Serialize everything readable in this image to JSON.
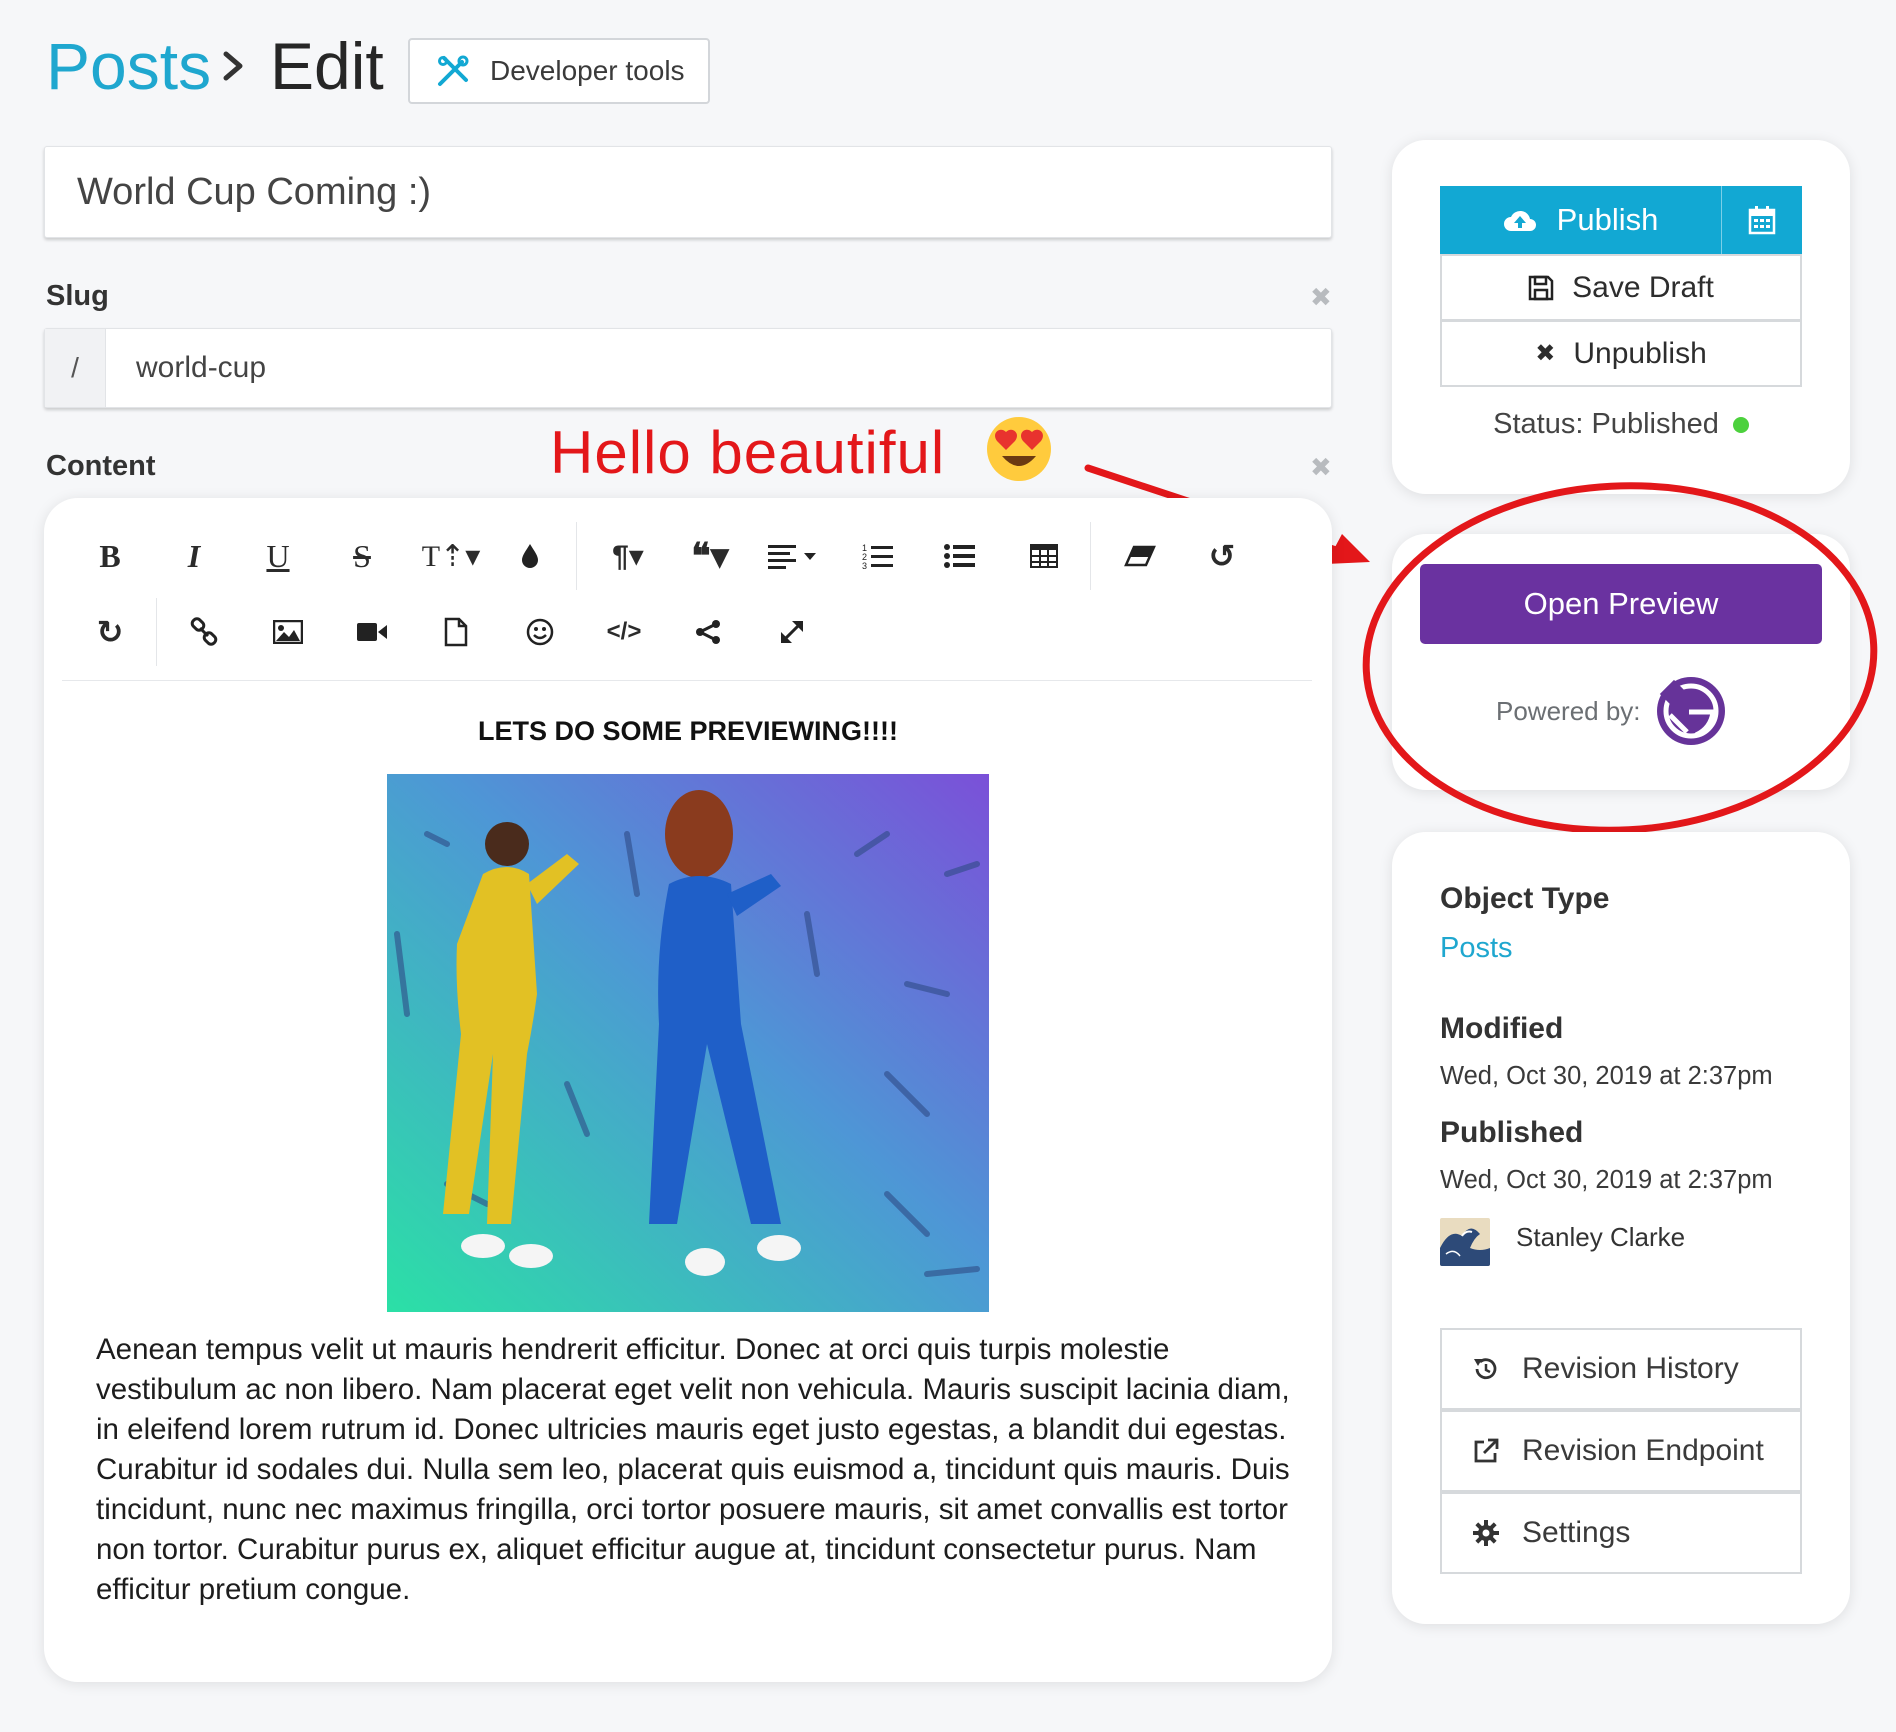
{
  "header": {
    "breadcrumb_root": "Posts",
    "breadcrumb_current": "Edit",
    "developer_tools_label": "Developer tools"
  },
  "title_field": {
    "value": "World Cup Coming :)"
  },
  "slug": {
    "label": "Slug",
    "prefix": "/",
    "value": "world-cup"
  },
  "content": {
    "label": "Content",
    "heading": "LETS DO SOME PREVIEWING!!!!",
    "paragraph": "Aenean tempus velit ut mauris hendrerit efficitur. Donec at orci quis turpis molestie vestibulum ac non libero. Nam placerat eget velit non vehicula. Mauris suscipit lacinia diam, in eleifend lorem rutrum id. Donec ultricies mauris eget justo egestas, a blandit dui egestas. Curabitur id sodales dui. Nulla sem leo, placerat quis euismod a, tincidunt quis mauris. Duis tincidunt, nunc nec maximus fringilla, orci tortor posuere mauris, sit amet convallis est tortor non tortor. Curabitur purus ex, aliquet efficitur augue at, tincidunt consectetur purus. Nam efficitur pretium congue."
  },
  "toolbar": {
    "row1": [
      "bold-icon",
      "italic-icon",
      "underline-icon",
      "strikethrough-icon",
      "text-size-icon",
      "color-drop-icon",
      "paragraph-icon",
      "quote-icon",
      "align-icon",
      "ordered-list-icon",
      "unordered-list-icon",
      "table-icon",
      "eraser-icon",
      "undo-icon"
    ],
    "row2": [
      "redo-icon",
      "link-icon",
      "image-icon",
      "video-icon",
      "file-icon",
      "emoji-icon",
      "code-icon",
      "share-icon",
      "fullscreen-icon"
    ]
  },
  "annotation": {
    "text": "Hello beautiful"
  },
  "publish_panel": {
    "publish_label": "Publish",
    "save_draft_label": "Save Draft",
    "unpublish_label": "Unpublish",
    "status_text": "Status: Published",
    "status_color": "#4cd13d",
    "accent_color": "#12a8d3"
  },
  "preview_panel": {
    "open_preview_label": "Open Preview",
    "powered_by_label": "Powered by:",
    "button_color": "#6a32a0"
  },
  "meta_panel": {
    "object_type_label": "Object Type",
    "object_type_value": "Posts",
    "modified_label": "Modified",
    "modified_value": "Wed, Oct 30, 2019 at 2:37pm",
    "published_label": "Published",
    "published_value": "Wed, Oct 30, 2019 at 2:37pm",
    "author_name": "Stanley Clarke",
    "revision_history_label": "Revision History",
    "revision_endpoint_label": "Revision Endpoint",
    "settings_label": "Settings"
  }
}
